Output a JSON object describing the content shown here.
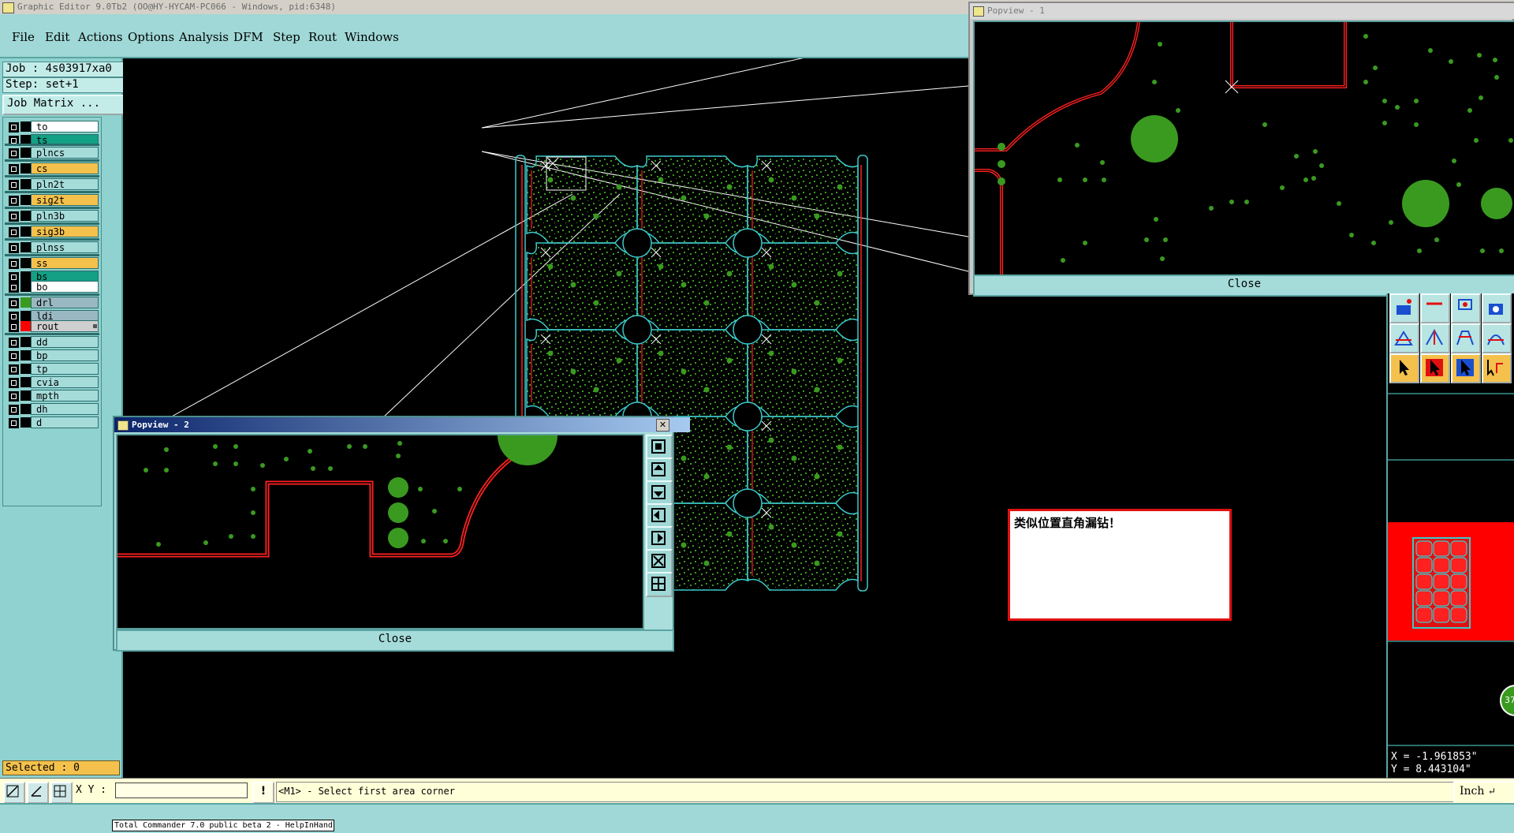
{
  "window_title": "Graphic Editor 9.0Tb2 (OO@HY-HYCAM-PC066 - Windows, pid:6348)",
  "menu": [
    "File",
    "Edit",
    "Actions",
    "Options",
    "Analysis",
    "DFM",
    "Step",
    "Rout",
    "Windows"
  ],
  "job": "Job : 4s03917xa0",
  "step": "Step: set+1",
  "job_matrix_button": "Job Matrix ...",
  "layers": [
    {
      "name": "to",
      "color": "#ffffff",
      "swatch": "#000000"
    },
    {
      "name": "ts",
      "color": "#14a085",
      "swatch": "#000000"
    },
    {
      "name": "plncs",
      "color": "#a5dcda",
      "swatch": "#000000"
    },
    {
      "name": "cs",
      "color": "#f4c14d",
      "swatch": "#000000"
    },
    {
      "name": "pln2t",
      "color": "#a5dcda",
      "swatch": "#000000"
    },
    {
      "name": "sig2t",
      "color": "#f4c14d",
      "swatch": "#000000"
    },
    {
      "name": "pln3b",
      "color": "#a5dcda",
      "swatch": "#000000"
    },
    {
      "name": "sig3b",
      "color": "#f4c14d",
      "swatch": "#000000"
    },
    {
      "name": "plnss",
      "color": "#a5dcda",
      "swatch": "#000000"
    },
    {
      "name": "ss",
      "color": "#f4c14d",
      "swatch": "#000000"
    },
    {
      "name": "bs",
      "color": "#14a085",
      "swatch": "#000000"
    },
    {
      "name": "bo",
      "color": "#ffffff",
      "swatch": "#000000"
    },
    {
      "name": "drl",
      "color": "#9ab8c2",
      "swatch": "#3a9a20"
    },
    {
      "name": "ldi",
      "color": "#9ab8c2",
      "swatch": "#000000"
    },
    {
      "name": "rout",
      "color": "#cfcfcf",
      "swatch": "#ff0000"
    },
    {
      "name": "dd",
      "color": "#a5dcda",
      "swatch": "#000000"
    },
    {
      "name": "bp",
      "color": "#a5dcda",
      "swatch": "#000000"
    },
    {
      "name": "tp",
      "color": "#a5dcda",
      "swatch": "#000000"
    },
    {
      "name": "cvia",
      "color": "#a5dcda",
      "swatch": "#000000"
    },
    {
      "name": "mpth",
      "color": "#a5dcda",
      "swatch": "#000000"
    },
    {
      "name": "dh",
      "color": "#a5dcda",
      "swatch": "#000000"
    },
    {
      "name": "d",
      "color": "#a5dcda",
      "swatch": "#000000"
    }
  ],
  "selected": "Selected : 0",
  "popview1": {
    "title": "Popview - 1",
    "close": "Close"
  },
  "popview2": {
    "title": "Popview - 2",
    "close": "Close"
  },
  "message": "类似位置直角漏钻！",
  "coords": {
    "x": "X = -1.961853\"",
    "y": "Y = 8.443104\""
  },
  "badge": "37",
  "cmd": {
    "xy_label": "X Y :",
    "xy_value": "",
    "prompt": "<M1> - Select first area corner",
    "unit": "Inch"
  },
  "tooltip": "Total Commander 7.0 public beta 2 - HelpInHand",
  "colors": {
    "panel": "#9fd8d6",
    "board_outline": "#3cc8c8",
    "rout": "#ff2020",
    "pads": "#3a9a20"
  }
}
